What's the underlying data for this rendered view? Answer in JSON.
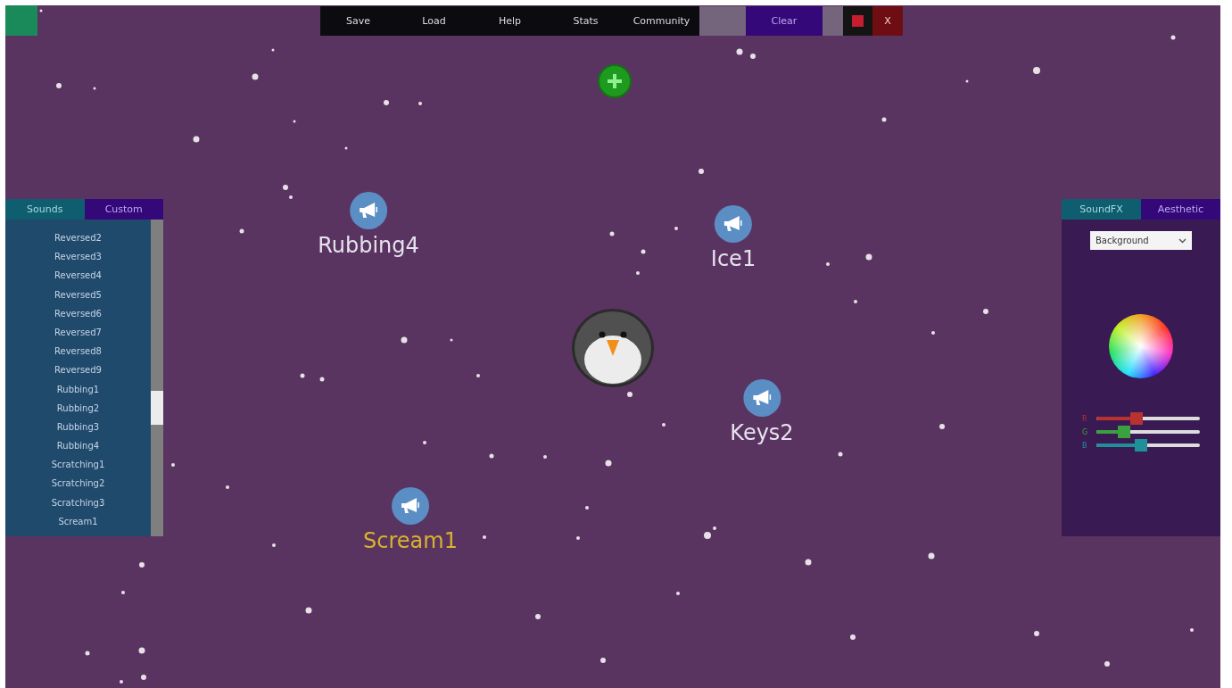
{
  "toolbar": [
    {
      "kind": "menu",
      "label": "Save"
    },
    {
      "kind": "menu",
      "label": "Load"
    },
    {
      "kind": "menu",
      "label": "Help"
    },
    {
      "kind": "menu",
      "label": "Stats"
    },
    {
      "kind": "menu",
      "label": "Community"
    },
    {
      "kind": "blank"
    },
    {
      "kind": "clear",
      "label": "Clear"
    },
    {
      "kind": "blank"
    },
    {
      "kind": "stop"
    },
    {
      "kind": "close",
      "label": "X"
    }
  ],
  "sound_panel": {
    "tabs": [
      {
        "label": "Sounds",
        "selected": true
      },
      {
        "label": "Custom",
        "selected": false
      }
    ],
    "items": [
      "Reversed2",
      "Reversed3",
      "Reversed4",
      "Reversed5",
      "Reversed6",
      "Reversed7",
      "Reversed8",
      "Reversed9",
      "Rubbing1",
      "Rubbing2",
      "Rubbing3",
      "Rubbing4",
      "Scratching1",
      "Scratching2",
      "Scratching3",
      "Scream1"
    ]
  },
  "canvas": {
    "nodes": [
      {
        "label": "Rubbing4",
        "selected": false
      },
      {
        "label": "Ice1",
        "selected": false
      },
      {
        "label": "Keys2",
        "selected": false
      },
      {
        "label": "Scream1",
        "selected": true
      }
    ]
  },
  "settings_panel": {
    "tabs": [
      {
        "label": "SoundFX",
        "selected": true
      },
      {
        "label": "Aesthetic",
        "selected": false
      }
    ],
    "dropdown": {
      "value": "Background"
    },
    "sliders": [
      {
        "label": "R",
        "color": "#b83232",
        "level": 0.39
      },
      {
        "label": "G",
        "color": "#3aa040",
        "level": 0.27
      },
      {
        "label": "B",
        "color": "#1f8f9a",
        "level": 0.43
      }
    ]
  }
}
